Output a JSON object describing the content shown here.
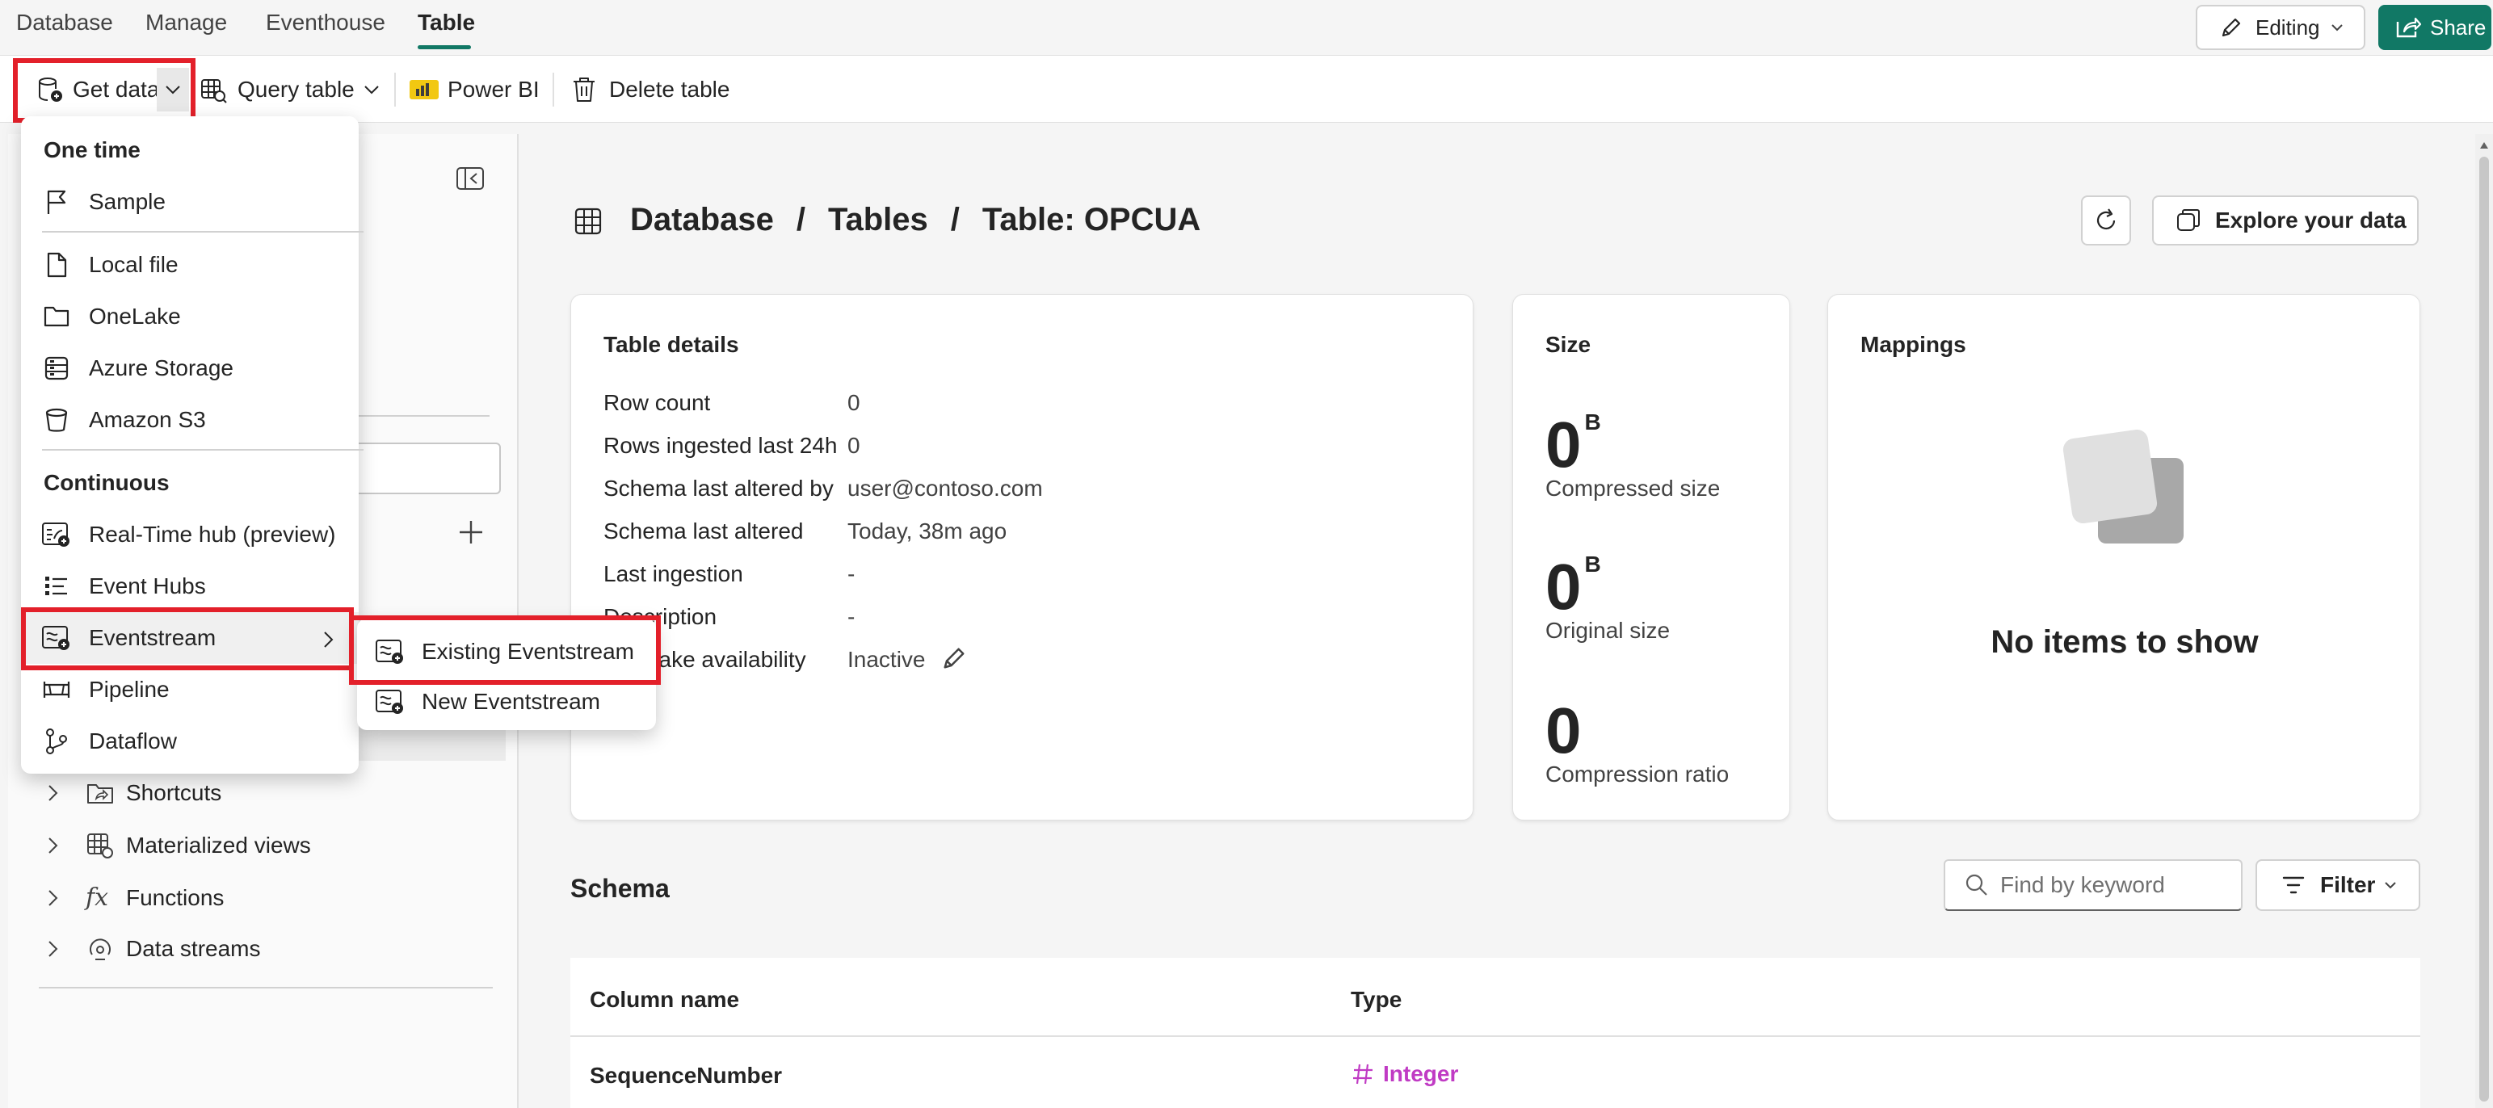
{
  "topnav": {
    "tabs": [
      "Database",
      "Manage",
      "Eventhouse",
      "Table"
    ],
    "active_tab": "Table",
    "editing_label": "Editing",
    "share_label": "Share"
  },
  "toolbar": {
    "get_data": "Get data",
    "query_table": "Query table",
    "power_bi": "Power BI",
    "delete_table": "Delete table"
  },
  "get_data_menu": {
    "one_time_header": "One time",
    "one_time_items": [
      "Sample",
      "Local file",
      "OneLake",
      "Azure Storage",
      "Amazon S3"
    ],
    "continuous_header": "Continuous",
    "continuous_items": [
      "Real-Time hub (preview)",
      "Event Hubs",
      "Eventstream",
      "Pipeline",
      "Dataflow"
    ],
    "eventstream_submenu": [
      "Existing Eventstream",
      "New Eventstream"
    ]
  },
  "explorer": {
    "tree_items": [
      "Shortcuts",
      "Materialized views",
      "Functions",
      "Data streams"
    ]
  },
  "main": {
    "breadcrumb": [
      "Database",
      "Tables",
      "Table: OPCUA"
    ],
    "breadcrumb_sep": "/",
    "explore_label": "Explore your data",
    "details": {
      "title": "Table details",
      "rows": [
        {
          "label": "Row count",
          "value": "0"
        },
        {
          "label": "Rows ingested last 24h",
          "value": "0"
        },
        {
          "label": "Schema last altered by",
          "value": "user@contoso.com"
        },
        {
          "label": "Schema last altered",
          "value": "Today, 38m ago"
        },
        {
          "label": "Last ingestion",
          "value": "-"
        },
        {
          "label": "Description",
          "value": "-"
        },
        {
          "label": "OneLake availability",
          "value": "Inactive"
        }
      ],
      "row4_visible_label": "Last ingestion",
      "row5_visible_label": "D",
      "row5_visible_tail": "scription",
      "row6_visible_tail": "ake availability"
    },
    "size": {
      "title": "Size",
      "metrics": [
        {
          "value": "0",
          "unit": "B",
          "label": "Compressed size"
        },
        {
          "value": "0",
          "unit": "B",
          "label": "Original size"
        },
        {
          "value": "0",
          "unit": "",
          "label": "Compression ratio"
        }
      ]
    },
    "mappings": {
      "title": "Mappings",
      "empty_text": "No items to show"
    },
    "schema": {
      "title": "Schema",
      "search_placeholder": "Find by keyword",
      "filter_label": "Filter",
      "columns": [
        "Column name",
        "Type"
      ],
      "rows": [
        {
          "name": "SequenceNumber",
          "type": "Integer"
        }
      ]
    }
  },
  "colors": {
    "accent": "#117865",
    "highlight_box": "#e3202a",
    "integer_type": "#c03bc4"
  }
}
